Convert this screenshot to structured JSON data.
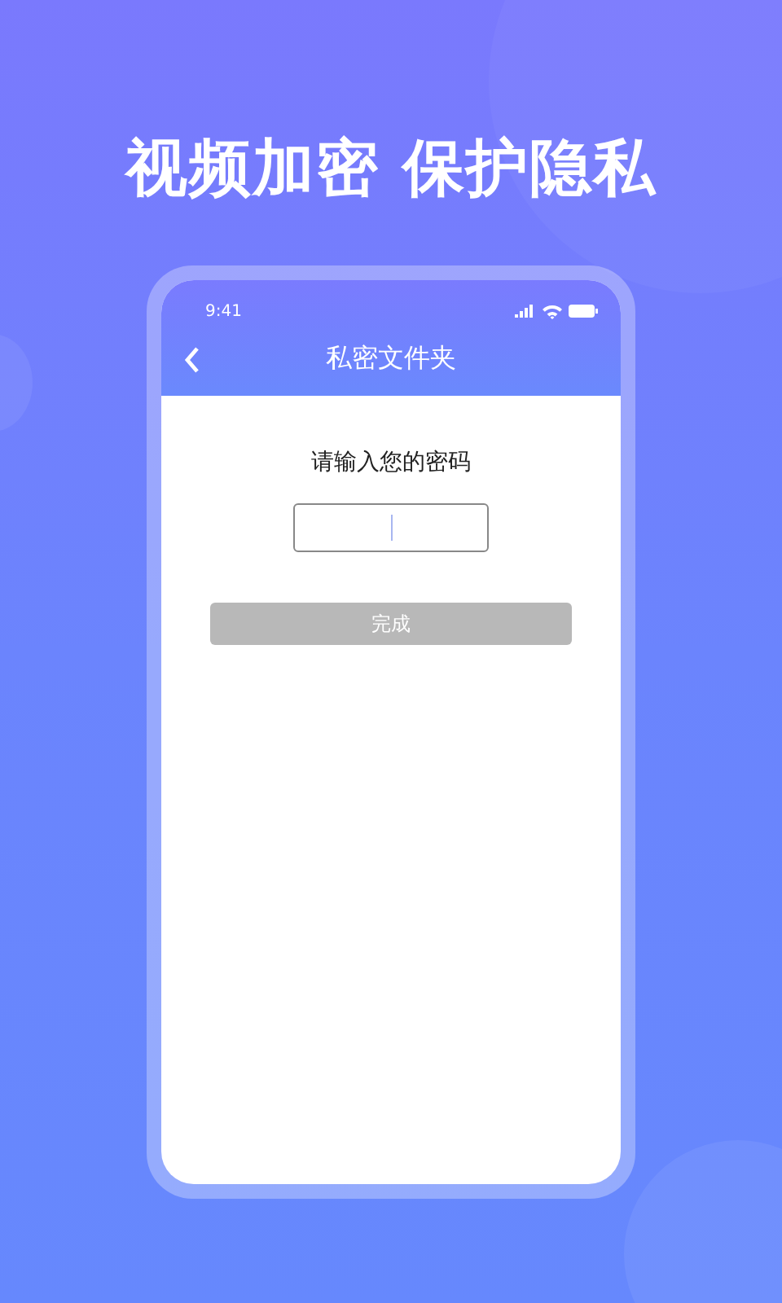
{
  "headline": "视频加密 保护隐私",
  "phone": {
    "status_bar": {
      "time": "9:41"
    },
    "nav": {
      "title": "私密文件夹"
    },
    "prompt": "请输入您的密码",
    "password_field": {
      "focused": true
    },
    "button": {
      "label": "完成",
      "disabled": true
    }
  }
}
